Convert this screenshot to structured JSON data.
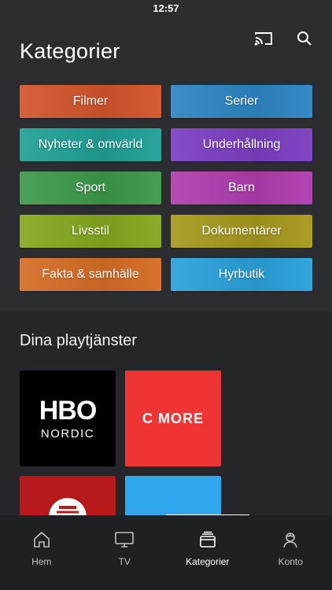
{
  "status_bar": {
    "time": "12:57"
  },
  "header": {
    "title": "Kategorier"
  },
  "categories": [
    {
      "label": "Filmer",
      "color": "#d4552b"
    },
    {
      "label": "Serier",
      "color": "#2d86c4"
    },
    {
      "label": "Nyheter & omvärld",
      "color": "#20a196"
    },
    {
      "label": "Underhållning",
      "color": "#7d3fc3"
    },
    {
      "label": "Sport",
      "color": "#3d9a4a"
    },
    {
      "label": "Barn",
      "color": "#b03eb0"
    },
    {
      "label": "Livsstil",
      "color": "#86a820"
    },
    {
      "label": "Dokumentärer",
      "color": "#a69a1d"
    },
    {
      "label": "Fakta & samhälle",
      "color": "#d76d25"
    },
    {
      "label": "Hyrbutik",
      "color": "#2aa2dd"
    }
  ],
  "play_services": {
    "title": "Dina playtjänster",
    "hbo": {
      "word": "HBO",
      "sub": "NORDIC"
    },
    "cmore": {
      "label": "C MORE"
    }
  },
  "tabs": [
    {
      "label": "Hem",
      "icon": "home-icon",
      "active": false
    },
    {
      "label": "TV",
      "icon": "tv-icon",
      "active": false
    },
    {
      "label": "Kategorier",
      "icon": "categories-icon",
      "active": true
    },
    {
      "label": "Konto",
      "icon": "account-icon",
      "active": false
    }
  ]
}
